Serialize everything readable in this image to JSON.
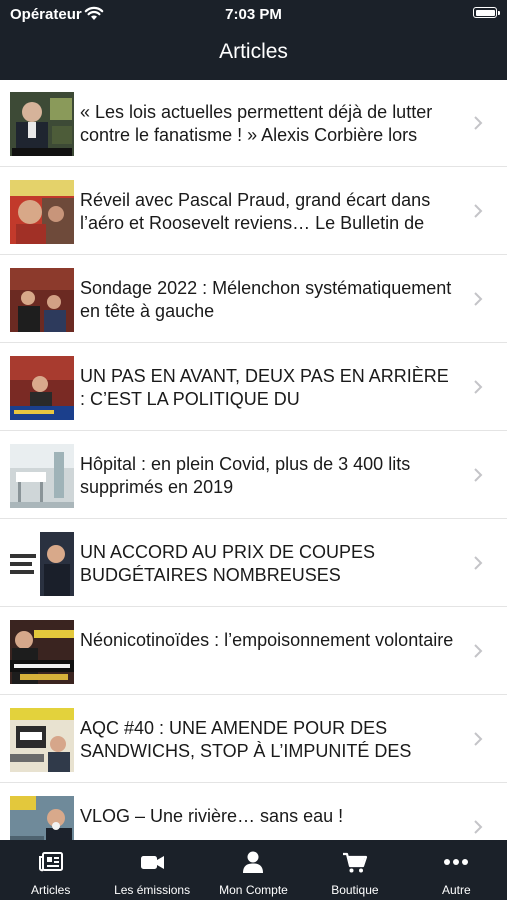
{
  "status_bar": {
    "carrier": "Opérateur",
    "time": "7:03 PM"
  },
  "nav": {
    "title": "Articles"
  },
  "articles": [
    {
      "title": "« Les lois actuelles permettent déjà de lutter contre le fanatisme ! » Alexis Corbière lors"
    },
    {
      "title": "Réveil avec Pascal Praud, grand écart dans l’aéro et Roosevelt reviens… Le Bulletin de"
    },
    {
      "title": "Sondage 2022 : Mélenchon systématiquement en tête à gauche"
    },
    {
      "title": "UN PAS EN AVANT, DEUX PAS EN ARRIÈRE : C’EST LA POLITIQUE DU"
    },
    {
      "title": "Hôpital : en plein Covid, plus de 3 400 lits supprimés en 2019"
    },
    {
      "title": "UN ACCORD AU PRIX DE COUPES BUDGÉTAIRES NOMBREUSES"
    },
    {
      "title": "Néonicotinoïdes : l’empoisonnement volontaire"
    },
    {
      "title": "AQC #40 : UNE AMENDE POUR DES SANDWICHS, STOP À L’IMPUNITÉ DES"
    },
    {
      "title": "VLOG – Une rivière… sans eau !"
    }
  ],
  "tabs": [
    {
      "label": "Articles",
      "icon": "newspaper-icon"
    },
    {
      "label": "Les émissions",
      "icon": "video-camera-icon"
    },
    {
      "label": "Mon Compte",
      "icon": "user-icon"
    },
    {
      "label": "Boutique",
      "icon": "cart-icon"
    },
    {
      "label": "Autre",
      "icon": "more-icon"
    }
  ],
  "colors": {
    "bar_background": "#1b2129",
    "separator": "#e4e4e4",
    "chevron": "#c4c4c8"
  }
}
